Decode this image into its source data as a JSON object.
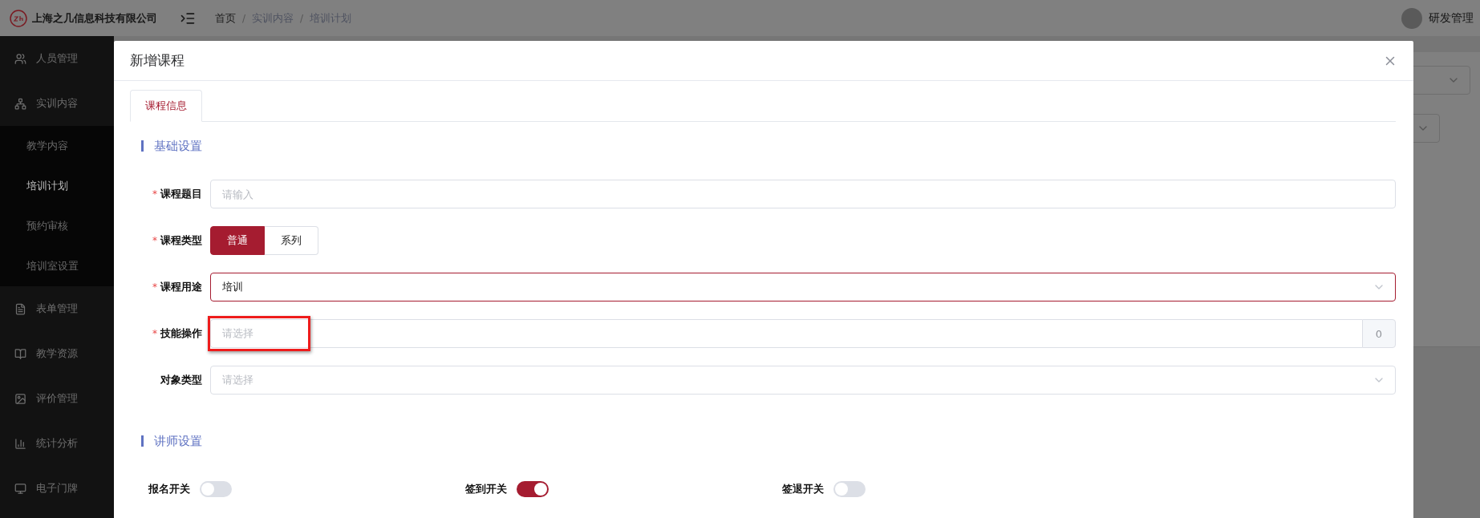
{
  "header": {
    "company": "上海之几信息科技有限公司",
    "breadcrumb": [
      {
        "kind": "link",
        "label": "首页"
      },
      {
        "kind": "separator",
        "label": "/"
      },
      {
        "kind": "text",
        "label": "实训内容"
      },
      {
        "kind": "separator",
        "label": "/"
      },
      {
        "kind": "text",
        "label": "培训计划"
      }
    ],
    "user": "研发管理"
  },
  "sidebar": {
    "items": [
      {
        "label": "人员管理"
      },
      {
        "label": "实训内容",
        "children": [
          {
            "label": "教学内容",
            "selected": false
          },
          {
            "label": "培训计划",
            "selected": true
          },
          {
            "label": "预约审核",
            "selected": false
          },
          {
            "label": "培训室设置",
            "selected": false
          }
        ]
      },
      {
        "label": "表单管理"
      },
      {
        "label": "教学资源"
      },
      {
        "label": "评价管理"
      },
      {
        "label": "统计分析"
      },
      {
        "label": "电子门牌"
      }
    ]
  },
  "dialog": {
    "title": "新增课程",
    "tabs": [
      {
        "label": "课程信息",
        "selected": true
      }
    ],
    "basic": {
      "title": "基础设置",
      "fields": [
        {
          "kind": "input",
          "label": "课程题目",
          "required_mark": "*",
          "placeholder": "请输入"
        },
        {
          "kind": "radio",
          "label": "课程类型",
          "required_mark": "*",
          "options": [
            {
              "label": "普通",
              "selected": true
            },
            {
              "label": "系列",
              "selected": false
            }
          ]
        },
        {
          "kind": "select",
          "label": "课程用途",
          "required_mark": "*",
          "value": "培训",
          "focused": true
        },
        {
          "kind": "picker",
          "label": "技能操作",
          "required_mark": "*",
          "placeholder": "请选择",
          "count": "0",
          "highlighted": true
        },
        {
          "kind": "select",
          "label": "对象类型",
          "placeholder": "请选择",
          "focused": false
        }
      ]
    },
    "teacher": {
      "title": "讲师设置",
      "switches": [
        {
          "label": "报名开关",
          "on": false
        },
        {
          "label": "签到开关",
          "on": true
        },
        {
          "label": "签退开关",
          "on": false
        }
      ]
    }
  }
}
